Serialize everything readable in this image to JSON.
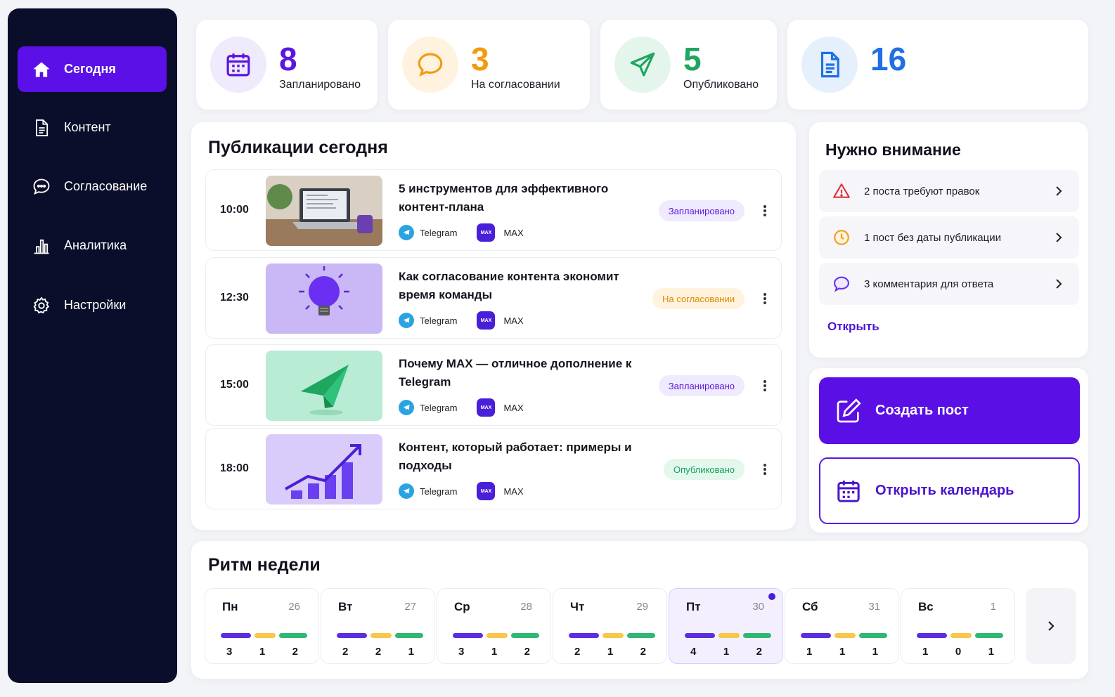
{
  "sidebar": {
    "items": [
      {
        "label": "Сегодня",
        "icon": "home-icon",
        "active": true
      },
      {
        "label": "Контент",
        "icon": "document-icon"
      },
      {
        "label": "Согласование",
        "icon": "chat-icon"
      },
      {
        "label": "Аналитика",
        "icon": "chart-icon"
      },
      {
        "label": "Настройки",
        "icon": "gear-icon"
      }
    ]
  },
  "stats": [
    {
      "value": "8",
      "label": "Запланировано",
      "color": "#5b16e0",
      "icon": "calendar-icon"
    },
    {
      "value": "3",
      "label": "На согласовании",
      "color": "#f29b0c",
      "icon": "chat-icon"
    },
    {
      "value": "5",
      "label": "Опубликовано",
      "color": "#1fa65f",
      "icon": "send-icon"
    },
    {
      "value": "16",
      "label": "",
      "color": "#1f6fe5",
      "icon": "document-icon"
    }
  ],
  "publications": {
    "title": "Публикации сегодня",
    "items": [
      {
        "time": "10:00",
        "title": "5 инструментов для эффективного контент-плана",
        "channel1": "Telegram",
        "channel2": "MAX",
        "status": "Запланировано"
      },
      {
        "time": "12:30",
        "title": "Как согласование контента экономит время команды",
        "channel1": "Telegram",
        "channel2": "MAX",
        "status": "На согласовании"
      },
      {
        "time": "15:00",
        "title": "Почему MAX — отличное дополнение к Telegram",
        "channel1": "Telegram",
        "channel2": "MAX",
        "status": "Запланировано"
      },
      {
        "time": "18:00",
        "title": "Контент, который работает: примеры и подходы",
        "channel1": "Telegram",
        "channel2": "MAX",
        "status": "Опубликовано"
      }
    ],
    "max_logo_text": "MAX"
  },
  "attention": {
    "title": "Нужно внимание",
    "items": [
      {
        "label": "2 поста требуют правок",
        "icon": "warning-icon"
      },
      {
        "label": "1 пост без даты публикации",
        "icon": "clock-icon"
      },
      {
        "label": "3 комментария для ответа",
        "icon": "comment-icon"
      }
    ],
    "open_link": "Открыть"
  },
  "actions": {
    "create_post": "Создать пост",
    "open_calendar": "Открыть календарь"
  },
  "week": {
    "title": "Ритм недели",
    "colors": {
      "planned": "#5b2ee0",
      "review": "#f7c64a",
      "published": "#2fb875"
    },
    "days": [
      {
        "name": "Пн",
        "date": "26",
        "planned": "3",
        "review": "1",
        "published": "2"
      },
      {
        "name": "Вт",
        "date": "27",
        "planned": "2",
        "review": "2",
        "published": "1"
      },
      {
        "name": "Ср",
        "date": "28",
        "planned": "3",
        "review": "1",
        "published": "2"
      },
      {
        "name": "Чт",
        "date": "29",
        "planned": "2",
        "review": "1",
        "published": "2"
      },
      {
        "name": "Пт",
        "date": "30",
        "planned": "4",
        "review": "1",
        "published": "2",
        "today": true
      },
      {
        "name": "Сб",
        "date": "31",
        "planned": "1",
        "review": "1",
        "published": "1"
      },
      {
        "name": "Вс",
        "date": "1",
        "planned": "1",
        "review": "0",
        "published": "1"
      }
    ]
  }
}
